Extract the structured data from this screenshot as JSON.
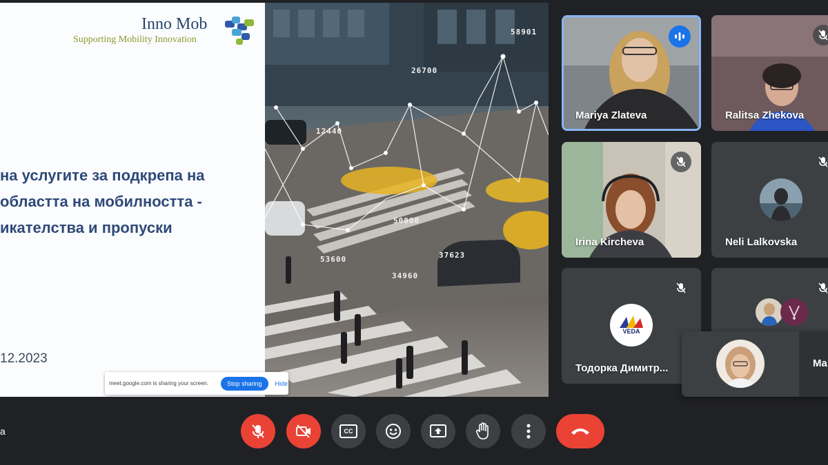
{
  "slide": {
    "logo_title": "Inno Mob",
    "logo_subtitle": "Supporting Mobility Innovation",
    "title_lines": [
      "на услугите за подкрепа на",
      "областта на мобилността -",
      "икателства и пропуски"
    ],
    "date": "12.2023",
    "data_labels": [
      "58901",
      "26700",
      "12440",
      "50000",
      "37623",
      "53600",
      "34960"
    ],
    "share_bar": {
      "text": "meet.google.com is sharing your screen.",
      "stop_label": "Stop sharing",
      "hide_label": "Hide"
    }
  },
  "participants": [
    {
      "name": "Mariya Zlateva",
      "state": "speaking"
    },
    {
      "name": "Ralitsa Zhekova",
      "state": "video"
    },
    {
      "name": "Irina Kircheva",
      "state": "muted"
    },
    {
      "name": "Neli Lalkovska",
      "state": "muted"
    },
    {
      "name": "Тодорка Димитр...",
      "state": "muted",
      "avatar_text": "VEDA"
    },
    {
      "name": "",
      "state": "muted"
    }
  ],
  "self_view": {
    "partial_name": "Ma"
  },
  "corner_label": "a",
  "controls": [
    {
      "name": "mic",
      "icon": "mic-off-icon",
      "color": "#ea4335"
    },
    {
      "name": "camera",
      "icon": "camera-off-icon",
      "color": "#ea4335"
    },
    {
      "name": "captions",
      "icon": "captions-icon",
      "label": "CC"
    },
    {
      "name": "reactions",
      "icon": "emoji-icon"
    },
    {
      "name": "present",
      "icon": "present-screen-icon"
    },
    {
      "name": "raise-hand",
      "icon": "hand-icon"
    },
    {
      "name": "more",
      "icon": "more-vert-icon"
    },
    {
      "name": "leave",
      "icon": "end-call-icon",
      "color": "#ea4335"
    }
  ]
}
